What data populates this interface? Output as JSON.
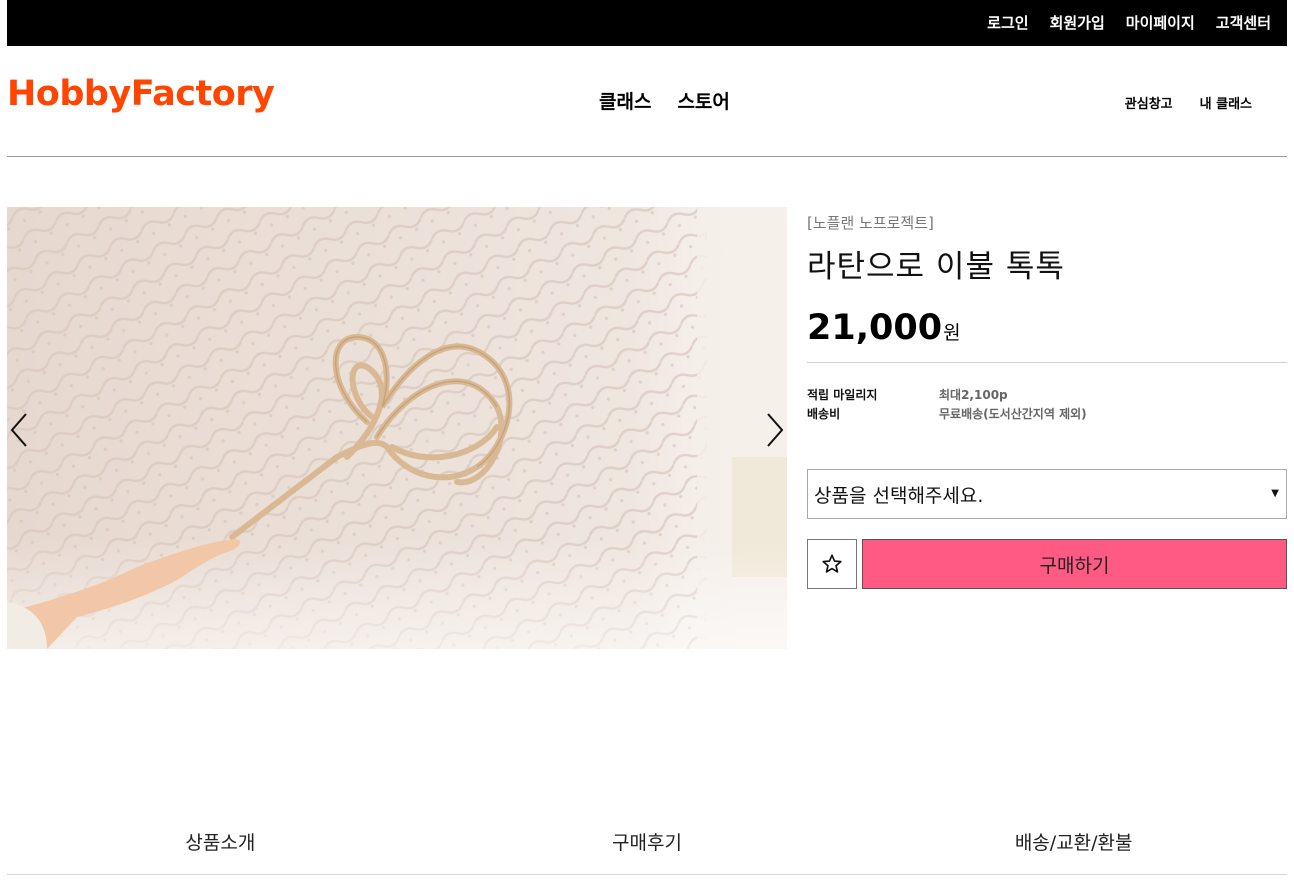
{
  "topbar": {
    "links": [
      "로그인",
      "회원가입",
      "마이페이지",
      "고객센터"
    ]
  },
  "header": {
    "logo": "HobbyFactory",
    "nav": [
      "클래스",
      "스토어"
    ],
    "subnav": [
      "관심창고",
      "내 클래스"
    ]
  },
  "product": {
    "brand": "[노플랜 노프로젝트]",
    "title": "라탄으로 이불 톡톡",
    "price": "21,000",
    "currency": "원",
    "meta": [
      {
        "label": "적립 마일리지",
        "value": "최대2,100p"
      },
      {
        "label": "배송비",
        "value": "무료배송(도서산간지역 제외)"
      }
    ],
    "select_placeholder": "상품을 선택해주세요.",
    "buy_label": "구매하기",
    "image_icon": "rattan-carpet-beater-photo"
  },
  "tabs": [
    "상품소개",
    "구매후기",
    "배송/교환/환불"
  ],
  "colors": {
    "logo": "#ff4500",
    "buy_button": "#ff5a83",
    "topbar": "#000000"
  }
}
